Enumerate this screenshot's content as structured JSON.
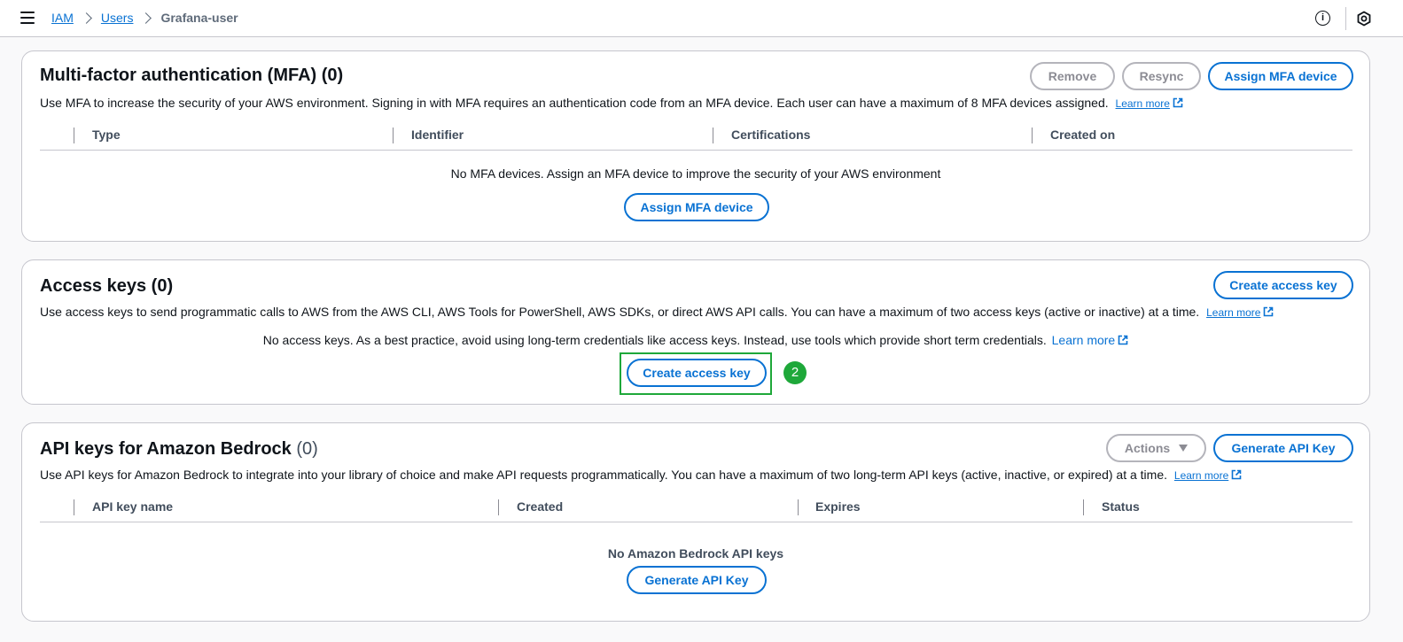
{
  "breadcrumb": {
    "items": [
      "IAM",
      "Users"
    ],
    "current": "Grafana-user"
  },
  "icons": {
    "menu": "hamburger-icon",
    "info": "info-icon",
    "settings": "hexagon-settings-icon",
    "external": "external-link-icon",
    "caret": "caret-down-icon"
  },
  "mfa": {
    "title": "Multi-factor authentication (MFA) (0)",
    "description": "Use MFA to increase the security of your AWS environment. Signing in with MFA requires an authentication code from an MFA device. Each user can have a maximum of 8 MFA devices assigned.",
    "learn_more": "Learn more",
    "buttons": {
      "remove": "Remove",
      "resync": "Resync",
      "assign": "Assign MFA device"
    },
    "columns": [
      "Type",
      "Identifier",
      "Certifications",
      "Created on"
    ],
    "empty_text": "No MFA devices. Assign an MFA device to improve the security of your AWS environment",
    "empty_button": "Assign MFA device"
  },
  "access_keys": {
    "title": "Access keys (0)",
    "description": "Use access keys to send programmatic calls to AWS from the AWS CLI, AWS Tools for PowerShell, AWS SDKs, or direct AWS API calls. You can have a maximum of two access keys (active or inactive) at a time.",
    "learn_more": "Learn more",
    "create_button": "Create access key",
    "empty_text": "No access keys. As a best practice, avoid using long-term credentials like access keys. Instead, use tools which provide short term credentials.",
    "empty_learn_more": "Learn more",
    "empty_button": "Create access key",
    "step_badge": "2"
  },
  "bedrock": {
    "title": "API keys for Amazon Bedrock",
    "count": "(0)",
    "description": "Use API keys for Amazon Bedrock to integrate into your library of choice and make API requests programmatically. You can have a maximum of two long-term API keys (active, inactive, or expired) at a time.",
    "learn_more": "Learn more",
    "actions_button": "Actions",
    "generate_button": "Generate API Key",
    "columns": [
      "API key name",
      "Created",
      "Expires",
      "Status"
    ],
    "empty_text": "No Amazon Bedrock API keys",
    "empty_button": "Generate API Key"
  },
  "colors": {
    "link": "#0972d3",
    "highlight": "#1ea83a",
    "border": "#c6c6cd"
  }
}
